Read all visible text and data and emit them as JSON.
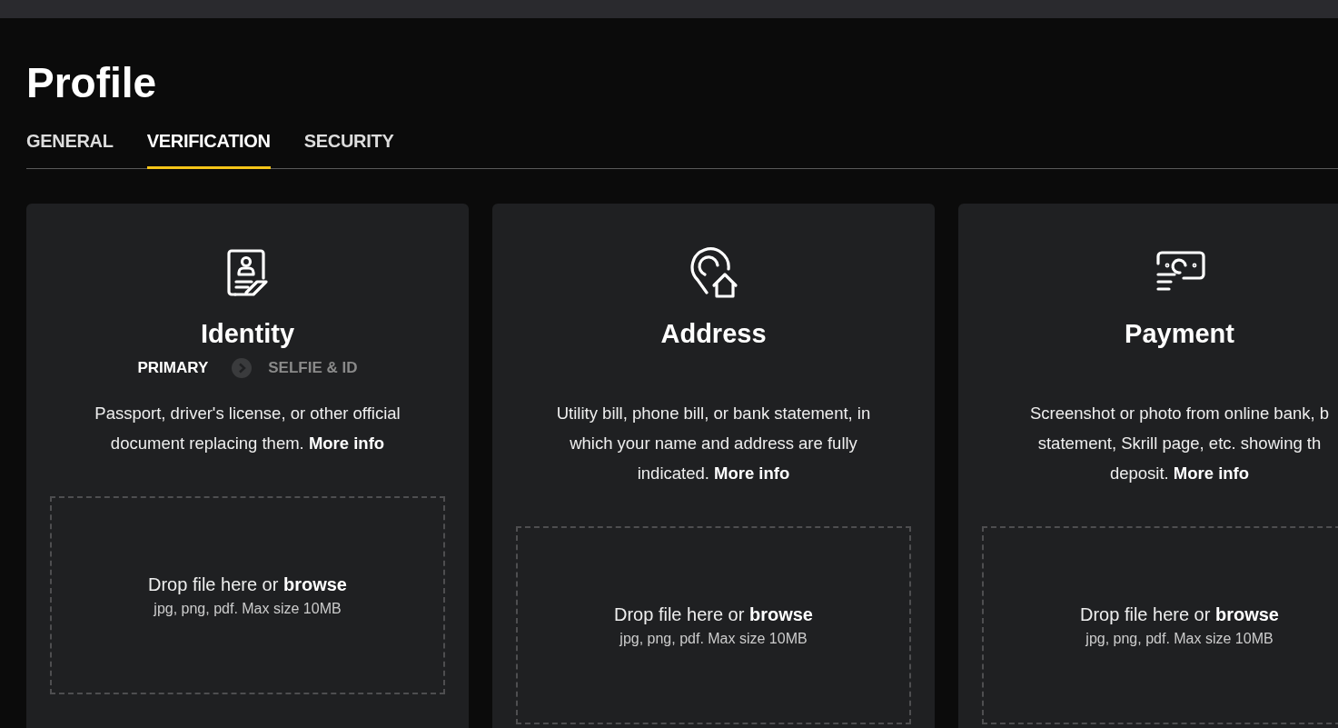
{
  "page": {
    "title": "Profile"
  },
  "tabs": [
    {
      "label": "GENERAL",
      "selected": false
    },
    {
      "label": "VERIFICATION",
      "selected": true
    },
    {
      "label": "SECURITY",
      "selected": false
    }
  ],
  "cards": [
    {
      "kind": "identity",
      "title": "Identity",
      "steps": [
        {
          "label": "PRIMARY",
          "selected": true
        },
        {
          "label": "SELFIE & ID",
          "selected": false
        }
      ],
      "description_lines": [
        "Passport, driver's license, or other official",
        "document replacing them."
      ],
      "link": "More info",
      "drop_text": "Drop file here or **browse**",
      "drop_hint": "jpg, png, pdf. Max size 10MB"
    },
    {
      "kind": "address",
      "title": "Address",
      "description_lines": [
        "Utility bill, phone bill, or bank statement, in",
        "which your name and address are fully",
        "indicated."
      ],
      "link": "More info",
      "drop_text": "Drop file here or **browse**",
      "drop_hint": "jpg, png, pdf. Max size 10MB"
    },
    {
      "kind": "payment",
      "title": "Payment",
      "description_lines": [
        "Screenshot or photo from online bank, b",
        "statement, Skrill page, etc. showing th",
        "deposit."
      ],
      "link": "More info",
      "drop_text": "Drop file here or **browse**",
      "drop_hint": "jpg, png, pdf. Max size 10MB"
    }
  ]
}
